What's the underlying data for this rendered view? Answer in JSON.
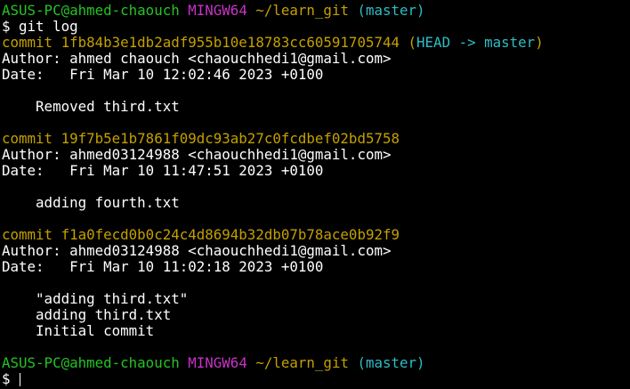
{
  "colors": {
    "green": "#25c325",
    "magenta": "#c733c7",
    "yellow": "#c4a000",
    "cyan": "#2fbcc6",
    "white": "#ffffff",
    "background": "#000000"
  },
  "prompt1": {
    "user_host": "ASUS-PC@ahmed-chaouch",
    "shell": "MINGW64",
    "path": "~/learn_git",
    "branch": "(master)"
  },
  "command": "$ git log",
  "commits": [
    {
      "hash_line": "commit 1fb84b3e1db2adf955b10e18783cc60591705744",
      "ref_open": "(",
      "ref_head": "HEAD -> master",
      "ref_close": ")",
      "author": "Author: ahmed chaouch <chaouchhedi1@gmail.com>",
      "date": "Date:   Fri Mar 10 12:02:46 2023 +0100",
      "message": [
        "    Removed third.txt"
      ]
    },
    {
      "hash_line": "commit 19f7b5e1b7861f09dc93ab27c0fcdbef02bd5758",
      "author": "Author: ahmed03124988 <chaouchhedi1@gmail.com>",
      "date": "Date:   Fri Mar 10 11:47:51 2023 +0100",
      "message": [
        "    adding fourth.txt"
      ]
    },
    {
      "hash_line": "commit f1a0fecd0b0c24c4d8694b32db07b78ace0b92f9",
      "author": "Author: ahmed03124988 <chaouchhedi1@gmail.com>",
      "date": "Date:   Fri Mar 10 11:02:18 2023 +0100",
      "message": [
        "    \"adding third.txt\"",
        "    adding third.txt",
        "    Initial commit"
      ]
    }
  ],
  "prompt2": {
    "user_host": "ASUS-PC@ahmed-chaouch",
    "shell": "MINGW64",
    "path": "~/learn_git",
    "branch": "(master)"
  },
  "input_prompt": "$ "
}
